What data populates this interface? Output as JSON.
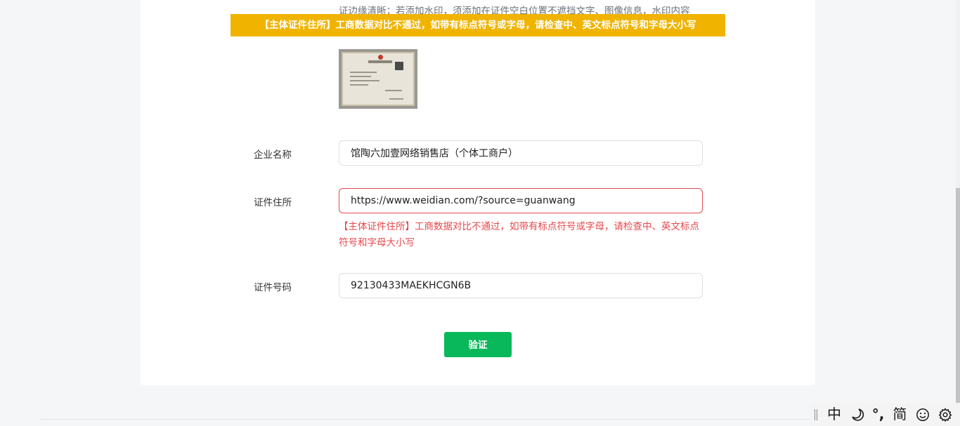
{
  "form": {
    "upload_hint": "证边缘清晰；若添加水印，须添加在证件空白位置不遮挡文字、图像信息，水印内容",
    "toast_message": "【主体证件住所】工商数据对比不通过，如带有标点符号或字母，请检查中、英文标点符号和字母大小写",
    "company_name": {
      "label": "企业名称",
      "value": "馆陶六加壹网络销售店（个体工商户）"
    },
    "address": {
      "label": "证件住所",
      "value": "https://www.weidian.com/?source=guanwang",
      "error": "【主体证件住所】工商数据对比不通过，如带有标点符号或字母，请检查中、英文标点符号和字母大小写"
    },
    "license_number": {
      "label": "证件号码",
      "value": "92130433MAEKHCGN6B"
    },
    "verify_label": "验证"
  },
  "ime_toolbar": {
    "mode": "中",
    "punct": "°,",
    "charset": "简",
    "icons": [
      "moon-icon",
      "smiley-icon",
      "gear-icon"
    ]
  },
  "colors": {
    "toast_bg": "#f0b400",
    "error": "#e5484d",
    "primary_button": "#09b85a"
  }
}
